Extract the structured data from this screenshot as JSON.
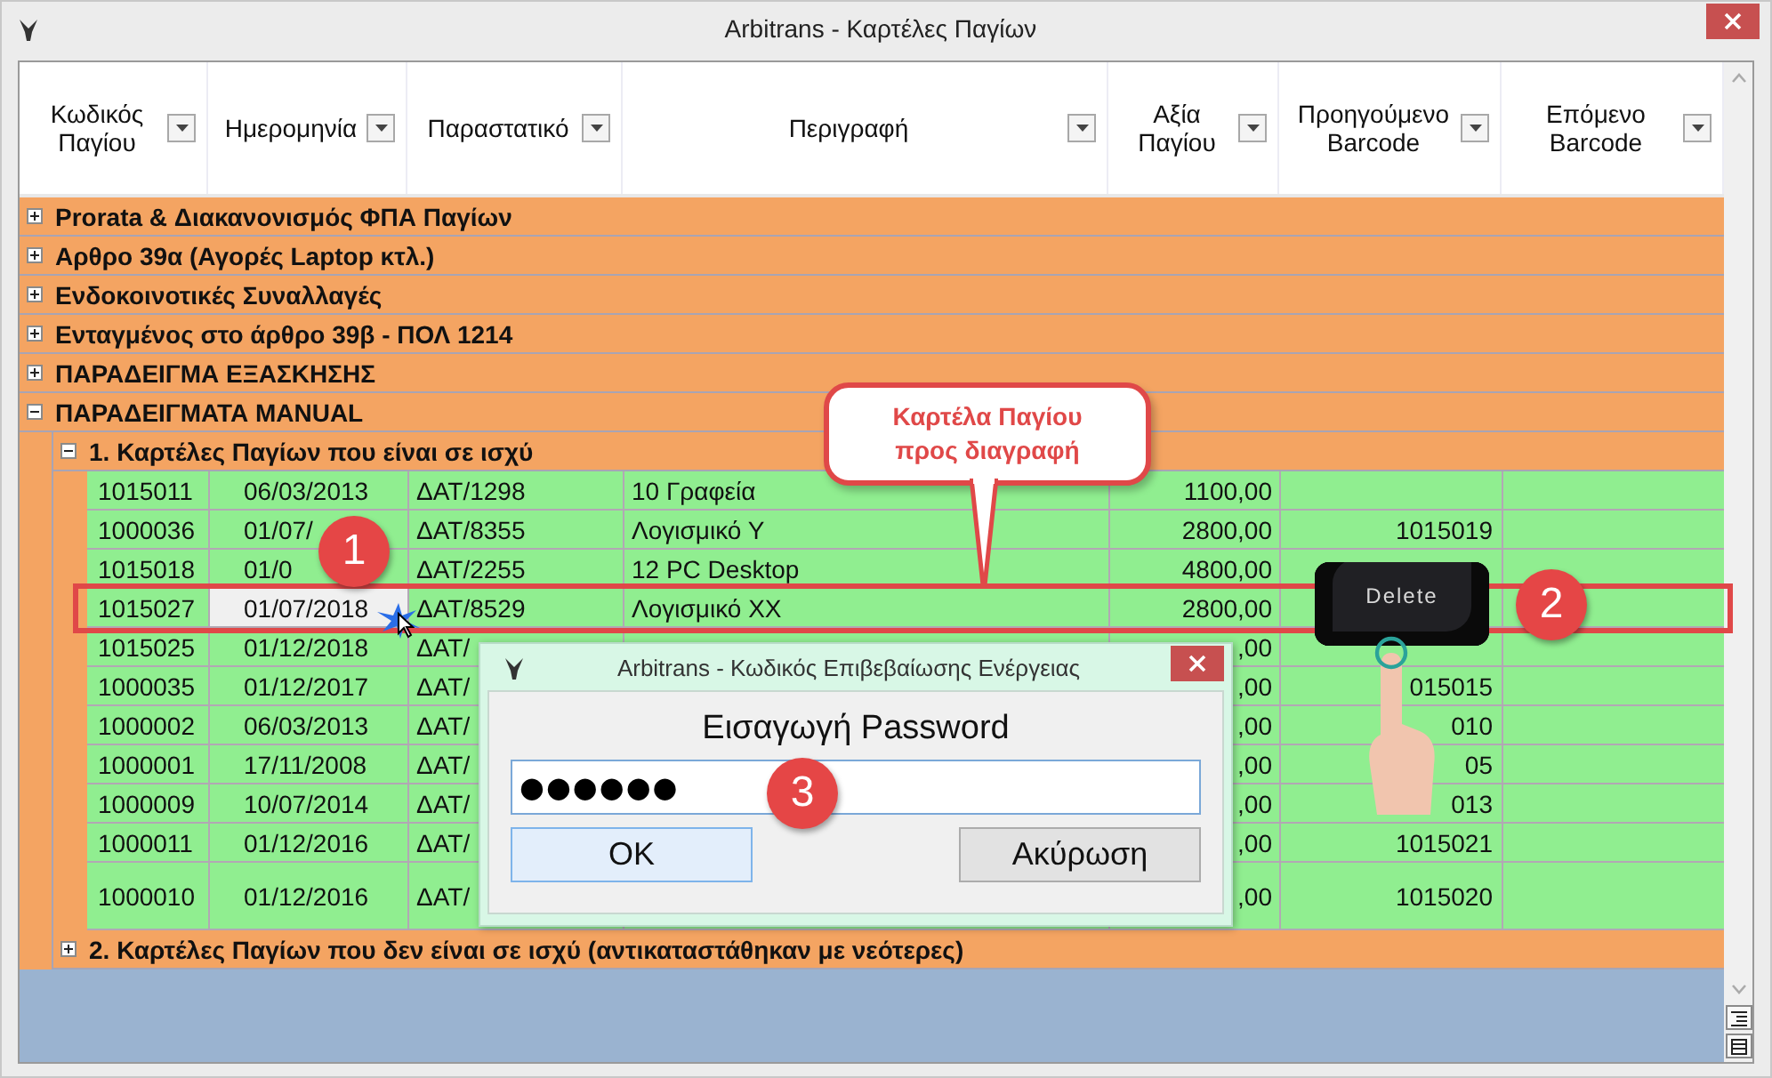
{
  "window": {
    "title": "Arbitrans - Καρτέλες Παγίων"
  },
  "table": {
    "columns": [
      "Κωδικός Παγίου",
      "Ημερομηνία",
      "Παραστατικό",
      "Περιγραφή",
      "Αξία Παγίου",
      "Προηγούμενο Barcode",
      "Επόμενο Barcode"
    ],
    "groups": [
      {
        "label": "Prorata & Διακανονισμός ΦΠΑ Παγίων",
        "expanded": false
      },
      {
        "label": "Αρθρο 39α (Αγορές Laptop κτλ.)",
        "expanded": false
      },
      {
        "label": "Ενδοκοινοτικές Συναλλαγές",
        "expanded": false
      },
      {
        "label": "Ενταγμένος στο άρθρο 39β - ΠΟΛ 1214",
        "expanded": false
      },
      {
        "label": "ΠΑΡΑΔΕΙΓΜΑ ΕΞΑΣΚΗΣΗΣ",
        "expanded": false
      },
      {
        "label": "ΠΑΡΑΔΕΙΓΜΑΤΑ MANUAL",
        "expanded": true,
        "children": [
          {
            "label": "1. Καρτέλες Παγίων που είναι σε ισχύ",
            "expanded": true,
            "rows": [
              {
                "cells": [
                  "1015011",
                  "06/03/2013",
                  "ΔΑΤ/1298",
                  "10 Γραφεία",
                  "1100,00",
                  "",
                  ""
                ],
                "focused": false
              },
              {
                "cells": [
                  "1000036",
                  "01/07/",
                  "ΔΑΤ/8355",
                  "Λογισμικό Υ",
                  "2800,00",
                  "1015019",
                  ""
                ],
                "focused": false
              },
              {
                "cells": [
                  "1015018",
                  "01/0",
                  "ΔΑΤ/2255",
                  "12 PC Desktop",
                  "4800,00",
                  "",
                  ""
                ],
                "focused": false
              },
              {
                "cells": [
                  "1015027",
                  "01/07/2018",
                  "ΔΑΤ/8529",
                  "Λογισμικό ΧΧ",
                  "2800,00",
                  "",
                  ""
                ],
                "focused": true
              },
              {
                "cells": [
                  "1015025",
                  "01/12/2018",
                  "ΔΑΤ/",
                  "",
                  ",00",
                  "",
                  ""
                ],
                "focused": false
              },
              {
                "cells": [
                  "1000035",
                  "01/12/2017",
                  "ΔΑΤ/",
                  "",
                  ",00",
                  "015015",
                  ""
                ],
                "focused": false
              },
              {
                "cells": [
                  "1000002",
                  "06/03/2013",
                  "ΔΑΤ/",
                  "",
                  ",00",
                  "010",
                  ""
                ],
                "focused": false
              },
              {
                "cells": [
                  "1000001",
                  "17/11/2008",
                  "ΔΑΤ/",
                  "",
                  ",00",
                  "05",
                  ""
                ],
                "focused": false
              },
              {
                "cells": [
                  "1000009",
                  "10/07/2014",
                  "ΔΑΤ/",
                  "",
                  ",00",
                  "013",
                  ""
                ],
                "focused": false
              },
              {
                "cells": [
                  "1000011",
                  "01/12/2016",
                  "ΔΑΤ/",
                  "",
                  ",00",
                  "1015021",
                  ""
                ],
                "focused": false
              },
              {
                "cells": [
                  "1000010",
                  "01/12/2016",
                  "ΔΑΤ/",
                  "",
                  ",00",
                  "1015020",
                  ""
                ],
                "focused": false
              }
            ]
          },
          {
            "label": "2. Καρτέλες Παγίων που δεν είναι σε ισχύ (αντικαταστάθηκαν με νεότερες)",
            "expanded": false
          }
        ]
      }
    ]
  },
  "dialog": {
    "title": "Arbitrans - Κωδικός Επιβεβαίωσης Ενέργειας",
    "prompt": "Εισαγωγή Password",
    "value": "●●●●●●",
    "buttons": [
      {
        "label": "OK",
        "default": true
      },
      {
        "label": "Ακύρωση",
        "default": false
      }
    ]
  },
  "annotations": {
    "callout": "Καρτέλα Παγίου\nπρος διαγραφή",
    "badges": [
      "1",
      "2",
      "3"
    ],
    "key": "Delete"
  }
}
